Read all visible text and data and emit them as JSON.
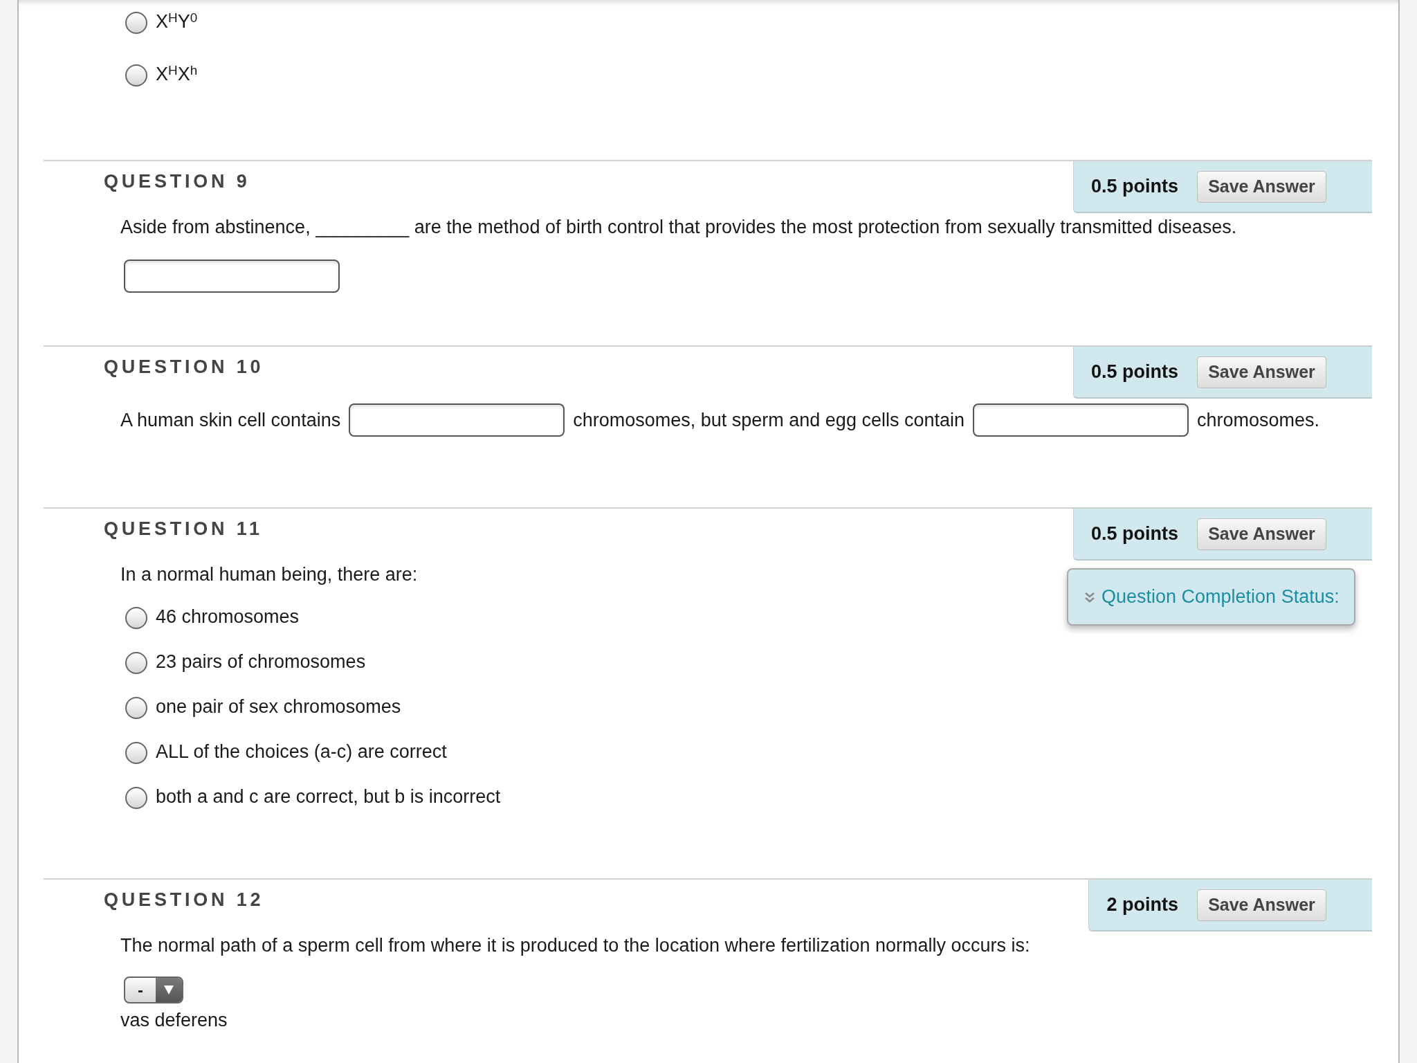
{
  "partial_question": {
    "options": [
      {
        "label": "X$^{H}$Y$^{0}$",
        "selected": false
      },
      {
        "label": "X$^{H}$X$^{h}$",
        "selected": false
      }
    ]
  },
  "questions": [
    {
      "kind": "fill_in",
      "title": "QUESTION 9",
      "points": "0.5 points",
      "save_button": "Save Answer",
      "prompt": "Aside from abstinence, _________ are the method of birth control that provides the most protection from sexually transmitted diseases."
    },
    {
      "kind": "inline_blanks",
      "title": "QUESTION 10",
      "points": "0.5 points",
      "save_button": "Save Answer",
      "parts": [
        {
          "kind": "text",
          "text": "A human skin cell contains"
        },
        {
          "kind": "blank"
        },
        {
          "kind": "text",
          "text": "chromosomes, but sperm and egg cells contain"
        },
        {
          "kind": "blank"
        },
        {
          "kind": "text",
          "text": "chromosomes."
        }
      ]
    },
    {
      "kind": "multiple_choice",
      "title": "QUESTION 11",
      "points": "0.5 points",
      "save_button": "Save Answer",
      "prompt": "In a normal human being, there are:",
      "options": [
        {
          "label": "46 chromosomes",
          "selected": false
        },
        {
          "label": "23 pairs of chromosomes",
          "selected": false
        },
        {
          "label": "one pair of sex chromosomes",
          "selected": false
        },
        {
          "label": "ALL of the choices (a-c) are correct",
          "selected": false
        },
        {
          "label": "both a and c are correct, but b is incorrect",
          "selected": false
        }
      ]
    },
    {
      "kind": "ordering",
      "title": "QUESTION 12",
      "points": "2 points",
      "save_button": "Save Answer",
      "prompt": "The normal path of a sperm cell from where it is produced to the location where fertilization normally occurs is:",
      "items": [
        {
          "choice": "-",
          "text": "vas deferens"
        }
      ]
    }
  ],
  "completion_status": {
    "label": "Question Completion Status:",
    "expanded": false
  }
}
